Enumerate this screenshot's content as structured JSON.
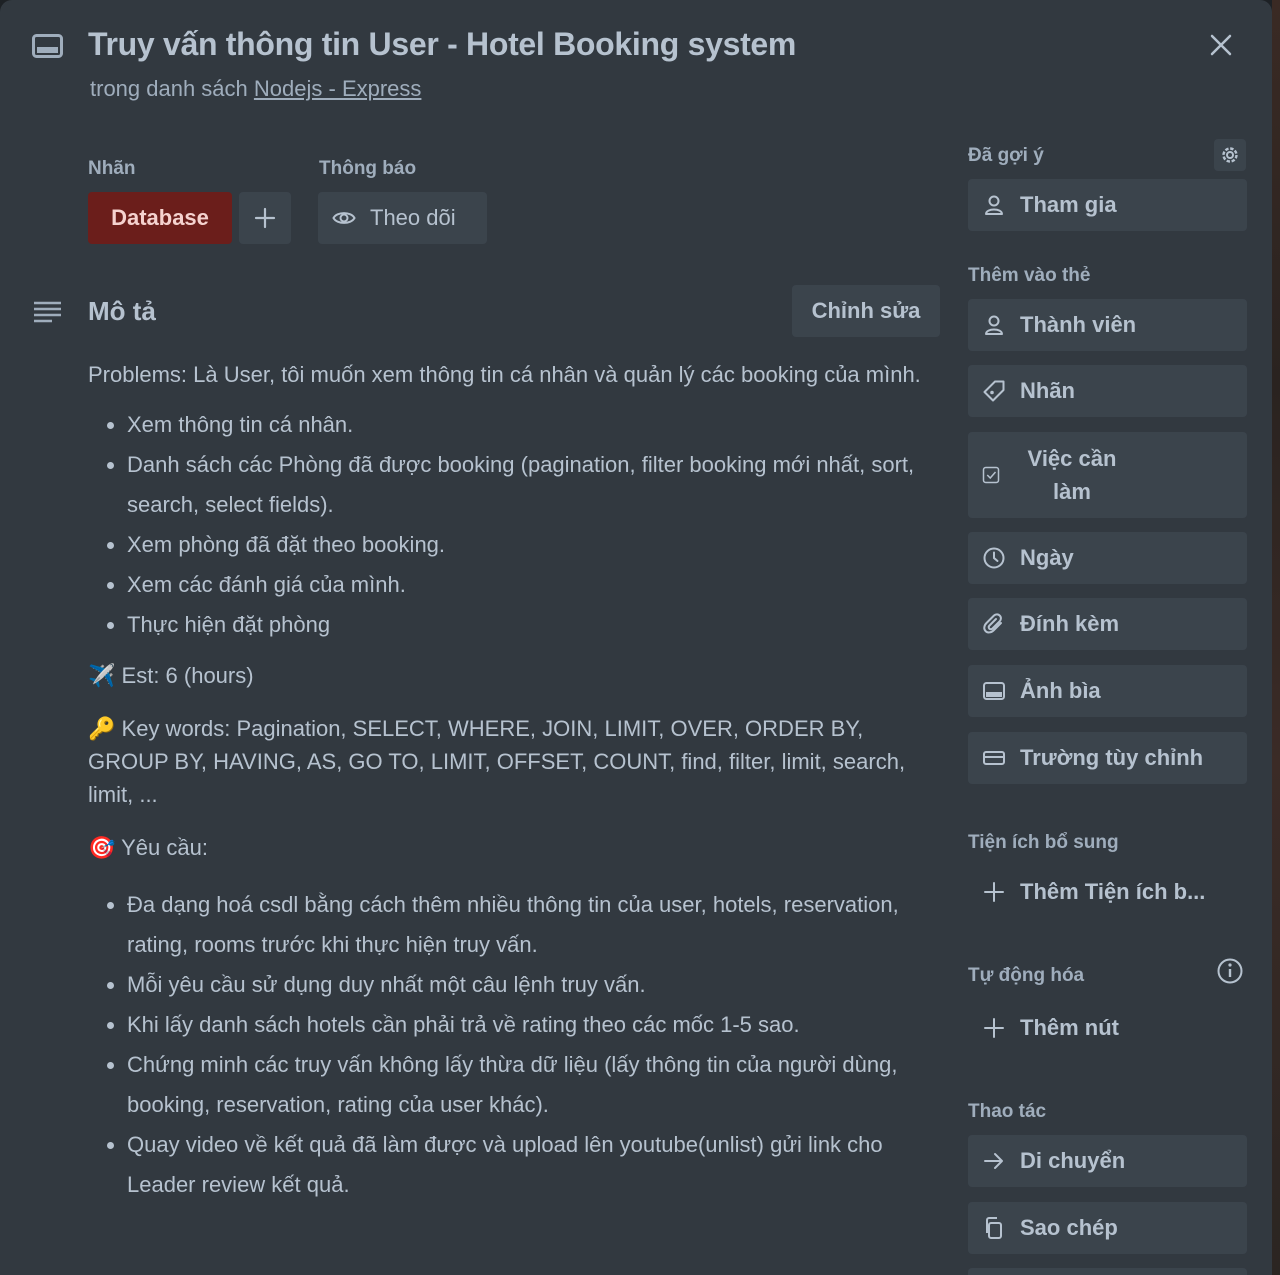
{
  "header": {
    "title": "Truy vấn thông tin User - Hotel Booking system",
    "subtitle_prefix": "trong danh sách ",
    "list_link": "Nodejs - Express"
  },
  "labels": {
    "section_label": "Nhãn",
    "label_chip": "Database",
    "label_color": "#6b1e1b",
    "add_label": "+"
  },
  "notifications": {
    "section_label": "Thông báo",
    "watch_button": "Theo dõi"
  },
  "description": {
    "title": "Mô tả",
    "edit_button": "Chỉnh sửa",
    "problems": "Problems: Là User, tôi muốn xem thông tin cá nhân và quản lý các booking của mình.",
    "problem_items": [
      "Xem thông tin cá nhân.",
      "Danh sách các Phòng đã được booking (pagination, filter booking mới nhất, sort, search, select fields).",
      "Xem phòng đã đặt theo booking.",
      "Xem các đánh giá của mình.",
      "Thực hiện đặt phòng"
    ],
    "est_icon": "✈️",
    "est": "Est: 6 (hours)",
    "keywords_icon": "🔑",
    "keywords": "Key words: Pagination, SELECT, WHERE, JOIN, LIMIT, OVER, ORDER BY, GROUP BY, HAVING, AS, GO TO, LIMIT, OFFSET, COUNT, find, filter, limit, search, limit, ...",
    "requirements_icon": "🎯",
    "requirements": "Yêu cầu:",
    "requirement_items": [
      "Đa dạng hoá csdl bằng cách thêm nhiều thông tin của user, hotels, reservation, rating, rooms trước khi thực hiện truy vấn.",
      "Mỗi yêu cầu sử dụng duy nhất một câu lệnh truy vấn.",
      "Khi lấy danh sách hotels cần phải trả về rating theo các mốc 1-5 sao.",
      "Chứng minh các truy vấn không lấy thừa dữ liệu (lấy thông tin của người dùng, booking, reservation, rating của user khác).",
      "Quay video về kết quả đã làm được và upload lên youtube(unlist) gửi link cho Leader review kết quả."
    ]
  },
  "sidebar": {
    "suggested_label": "Đã gợi ý",
    "join_button": "Tham gia",
    "add_to_card_label": "Thêm vào thẻ",
    "members_button": "Thành viên",
    "labels_button": "Nhãn",
    "checklist_button": "Việc cần làm",
    "dates_button": "Ngày",
    "attachment_button": "Đính kèm",
    "cover_button": "Ảnh bìa",
    "custom_fields_button": "Trường tùy chỉnh",
    "powerups_label": "Tiện ích bổ sung",
    "add_powerup": "Thêm Tiện ích b...",
    "automation_label": "Tự động hóa",
    "add_button": "Thêm nút",
    "actions_label": "Thao tác",
    "move_button": "Di chuyển",
    "copy_button": "Sao chép"
  }
}
